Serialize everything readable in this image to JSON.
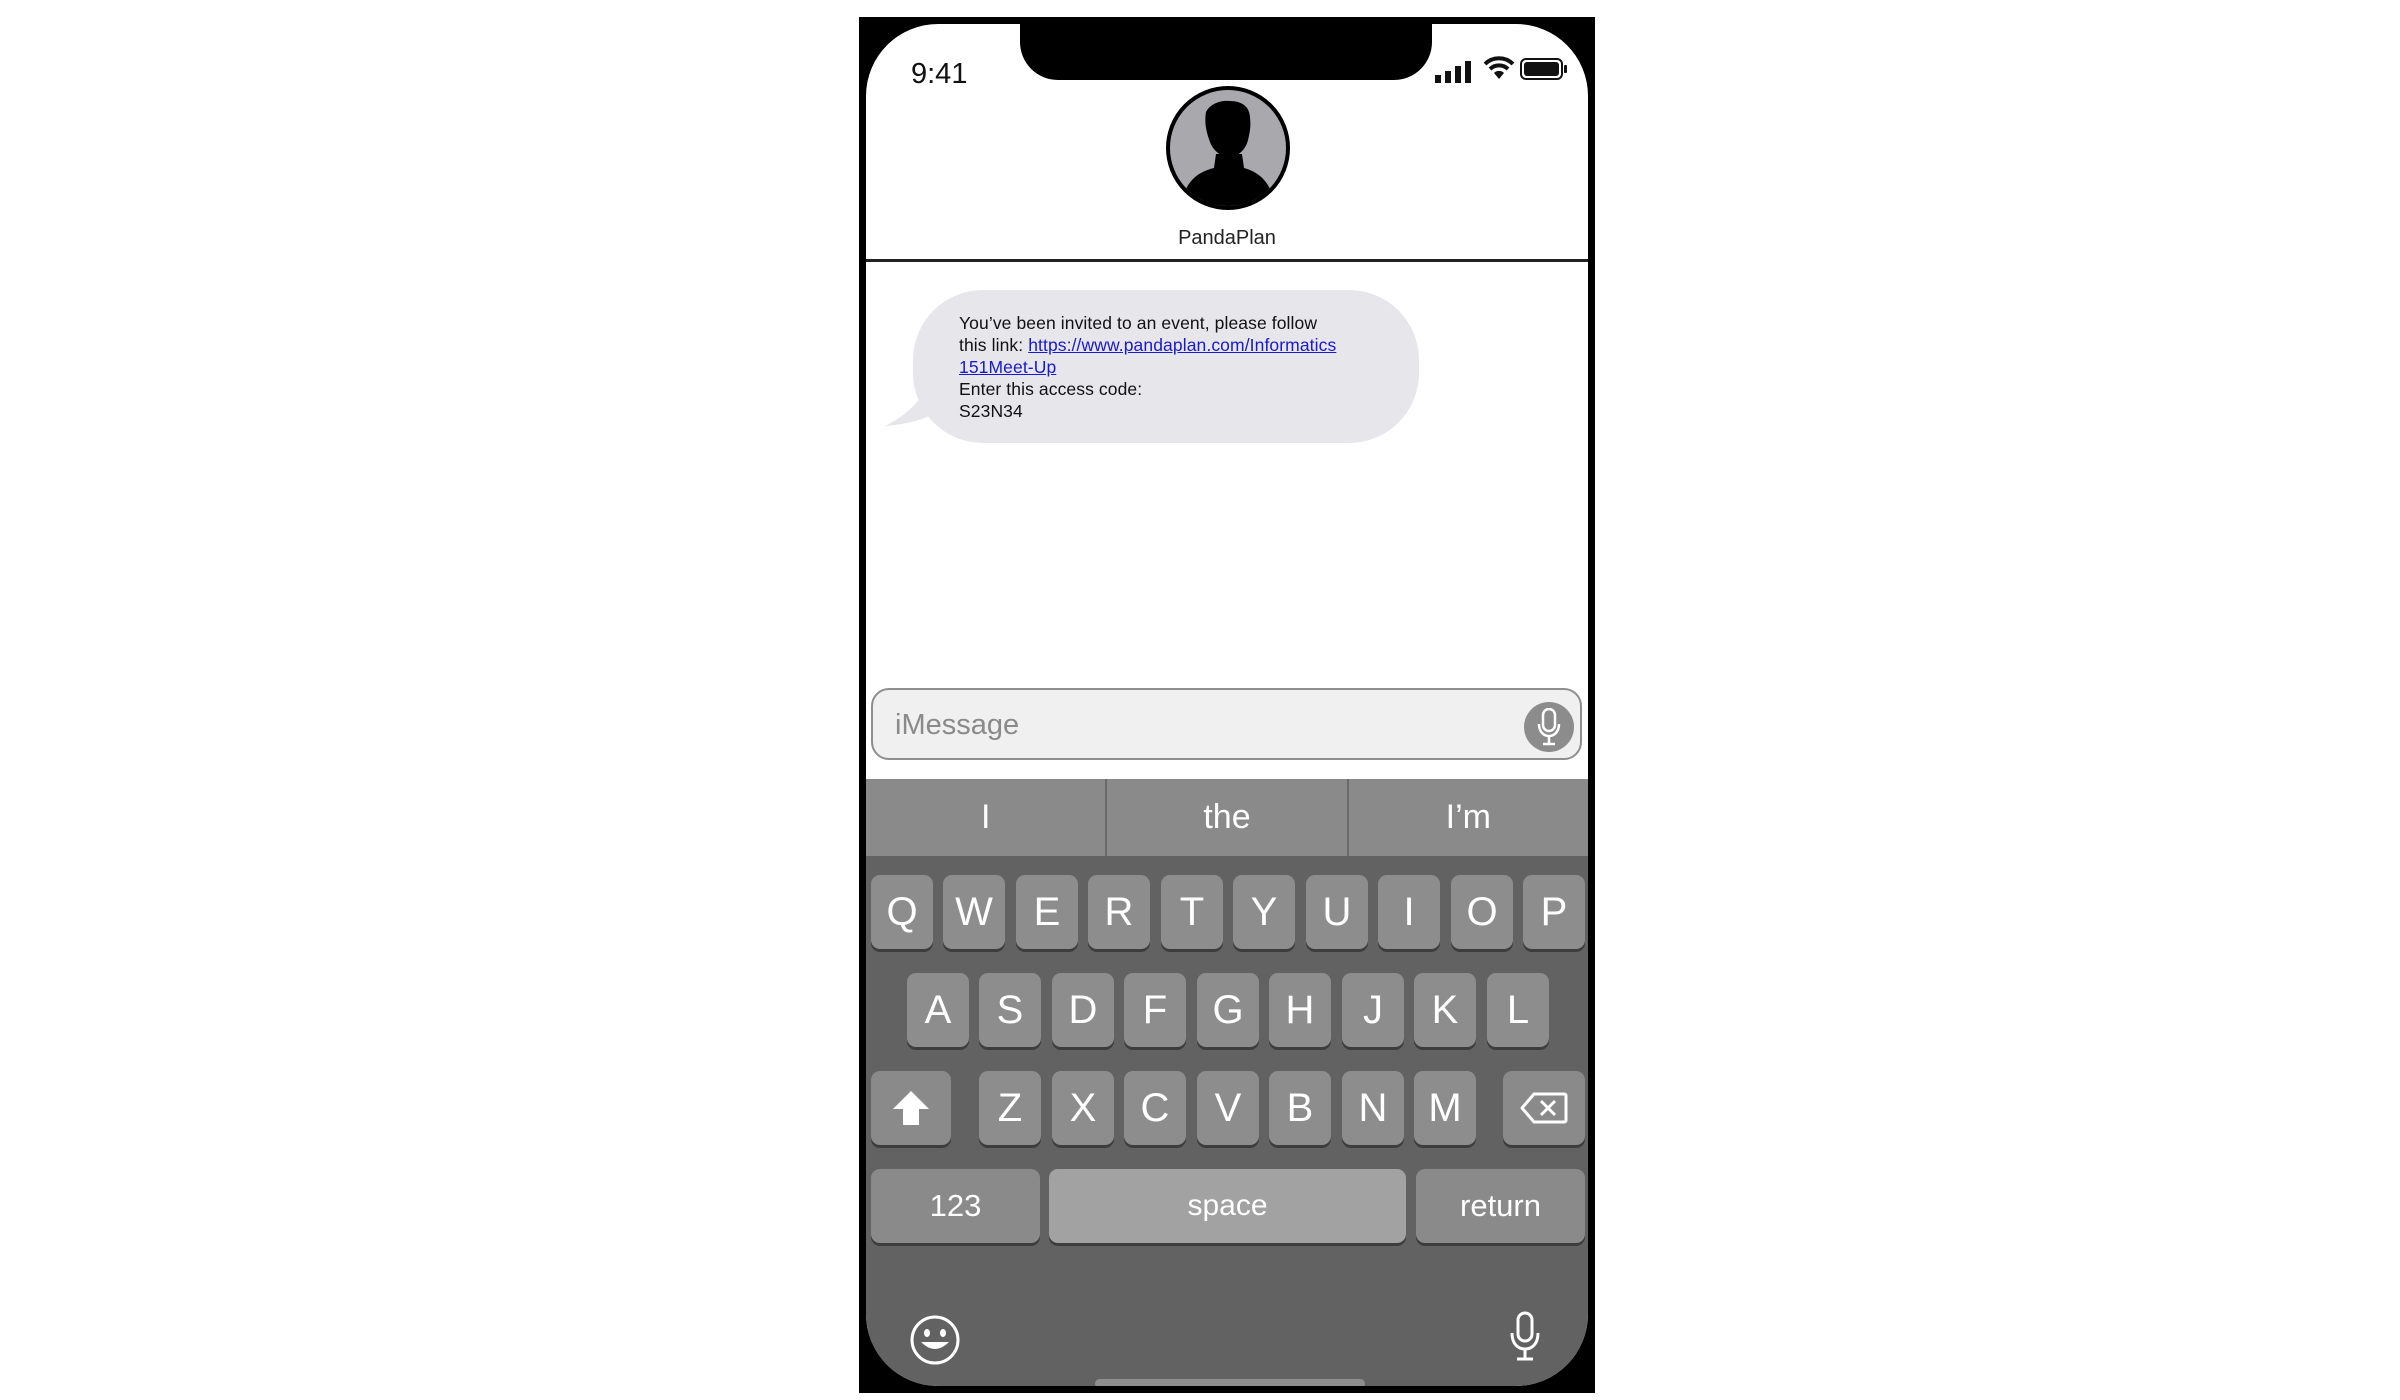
{
  "status_bar": {
    "time": "9:41"
  },
  "contact": {
    "name": "PandaPlan"
  },
  "message": {
    "line1": "You’ve been invited to an event, please follow",
    "line2_prefix": "this link: ",
    "link_part1": "https://www.pandaplan.com/Informatics",
    "link_part2": "151Meet-Up",
    "line4": "Enter this access code:",
    "code": "S23N34"
  },
  "input": {
    "placeholder": "iMessage"
  },
  "keyboard": {
    "predictions": [
      "I",
      "the",
      "I’m"
    ],
    "row1": [
      "Q",
      "W",
      "E",
      "R",
      "T",
      "Y",
      "U",
      "I",
      "O",
      "P"
    ],
    "row2": [
      "A",
      "S",
      "D",
      "F",
      "G",
      "H",
      "J",
      "K",
      "L"
    ],
    "row3": [
      "Z",
      "X",
      "C",
      "V",
      "B",
      "N",
      "M"
    ],
    "numbers_label": "123",
    "space_label": "space",
    "return_label": "return"
  }
}
